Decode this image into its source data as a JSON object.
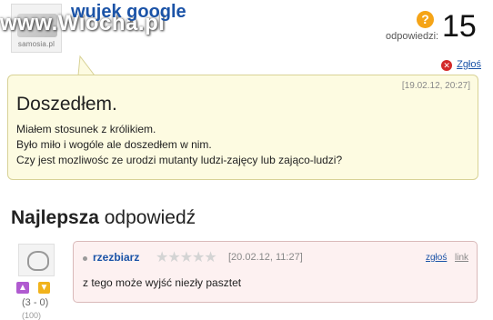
{
  "header": {
    "avatar_caption": "samosia.pl",
    "watermark": "www.Wiocha.pl",
    "username": "wujek google",
    "answers_label": "odpowiedzi:",
    "answers_count": "15",
    "answers_icon": "question-icon",
    "answers_icon_glyph": "?"
  },
  "report": {
    "label": "Zgłoś",
    "icon": "close-icon",
    "icon_glyph": "✕"
  },
  "question": {
    "date": "[19.02.12, 20:27]",
    "title": "Doszedłem.",
    "lines": [
      "Miałem stosunek z królikiem.",
      "Było miło i wogóle ale doszedłem w nim.",
      "Czy jest mozliwośc ze urodzi mutanty ludzi-zajęcy lub zająco-ludzi?"
    ]
  },
  "best": {
    "title_bold": "Najlepsza",
    "title_rest": "odpowiedź"
  },
  "answer": {
    "user": "rzezbiarz",
    "stars": "★★★★★",
    "rating_value": 0,
    "date": "[20.02.12, 11:27]",
    "report": "zgłoś",
    "link": "link",
    "text": "z tego może wyjść niezły pasztet",
    "votes": "(3 - 0)",
    "votes_extra": "(100)",
    "vote_up_icon": "thumbs-up-icon",
    "vote_down_icon": "thumbs-down-icon",
    "vote_up_glyph": "▲",
    "vote_down_glyph": "▼"
  },
  "colors": {
    "link": "#1b53a7",
    "question_bg": "#fdfbe1",
    "answer_bg": "#fdf1f1",
    "answers_icon": "#f5a417",
    "report_icon": "#d32a2a"
  }
}
